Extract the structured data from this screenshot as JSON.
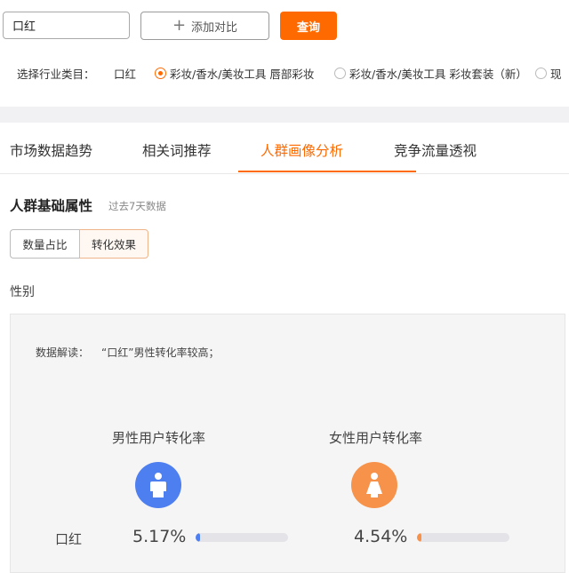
{
  "search": {
    "value": "口红"
  },
  "buttons": {
    "add_compare": "添加对比",
    "query": "查询"
  },
  "industry": {
    "label": "选择行业类目：",
    "current": "口红",
    "options": [
      {
        "label": "彩妆/香水/美妆工具 唇部彩妆",
        "checked": true
      },
      {
        "label": "彩妆/香水/美妆工具 彩妆套装（新）",
        "checked": false
      },
      {
        "label": "现",
        "checked": false
      }
    ]
  },
  "tabs": [
    {
      "label": "市场数据趋势",
      "active": false
    },
    {
      "label": "相关词推荐",
      "active": false
    },
    {
      "label": "人群画像分析",
      "active": true
    },
    {
      "label": "竞争流量透视",
      "active": false
    }
  ],
  "section": {
    "title": "人群基础属性",
    "subtitle": "过去7天数据"
  },
  "toggle": {
    "options": [
      "数量占比",
      "转化效果"
    ],
    "selected": "转化效果"
  },
  "gender": {
    "label": "性别",
    "insight_label": "数据解读：",
    "insight_text": "“口红”男性转化率较高；",
    "row_label": "口红",
    "metrics": [
      {
        "title": "男性用户转化率",
        "value": "5.17%",
        "fraction": 0.0517,
        "color": "#4e7ff0",
        "icon": "male-user-icon"
      },
      {
        "title": "女性用户转化率",
        "value": "4.54%",
        "fraction": 0.0454,
        "color": "#f7924a",
        "icon": "female-user-icon"
      }
    ]
  },
  "colors": {
    "accent": "#ff6a00",
    "male": "#4e7ff0",
    "female": "#f7924a"
  }
}
